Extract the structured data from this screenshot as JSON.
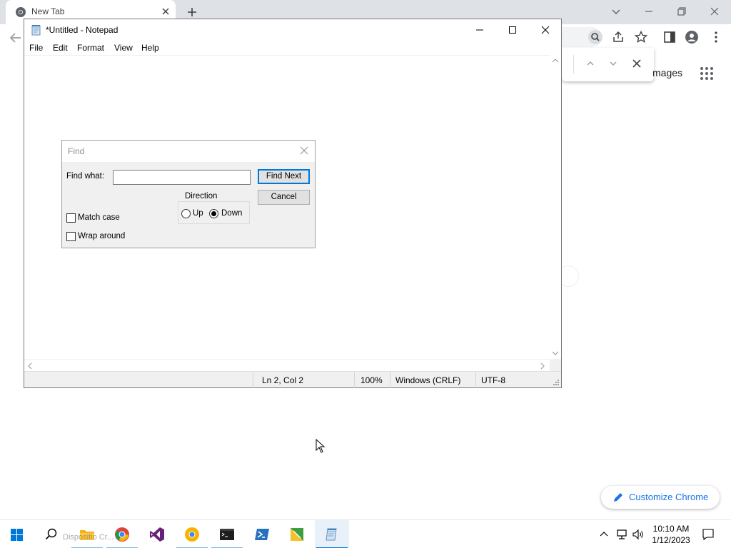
{
  "chrome": {
    "tab_title": "New Tab",
    "images_link": "mages",
    "customize_label": "Customize Chrome"
  },
  "notepad": {
    "title": "*Untitled - Notepad",
    "menus": [
      "File",
      "Edit",
      "Format",
      "View",
      "Help"
    ],
    "status": {
      "position": "Ln 2, Col 2",
      "zoom": "100%",
      "line_ending": "Windows (CRLF)",
      "encoding": "UTF-8"
    }
  },
  "find_dialog": {
    "title": "Find",
    "find_what_label": "Find what:",
    "find_what_value": "",
    "find_next_label": "Find Next",
    "cancel_label": "Cancel",
    "direction_label": "Direction",
    "up_label": "Up",
    "down_label": "Down",
    "direction_selected": "down",
    "match_case_label": "Match case",
    "match_case_checked": false,
    "wrap_around_label": "Wrap around",
    "wrap_around_checked": false
  },
  "taskbar": {
    "apps": [
      "file-explorer-icon",
      "chrome-icon",
      "visual-studio-icon",
      "chrome-canary-icon",
      "terminal-icon",
      "powershell-icon",
      "app-icon",
      "notepad-icon"
    ],
    "ghost_label": "Dispositio Cr...",
    "time": "10:10 AM",
    "date": "1/12/2023"
  },
  "colors": {
    "accent": "#0078d7",
    "chrome_blue": "#1a73e8",
    "taskbar_running": "#76b9ed"
  }
}
